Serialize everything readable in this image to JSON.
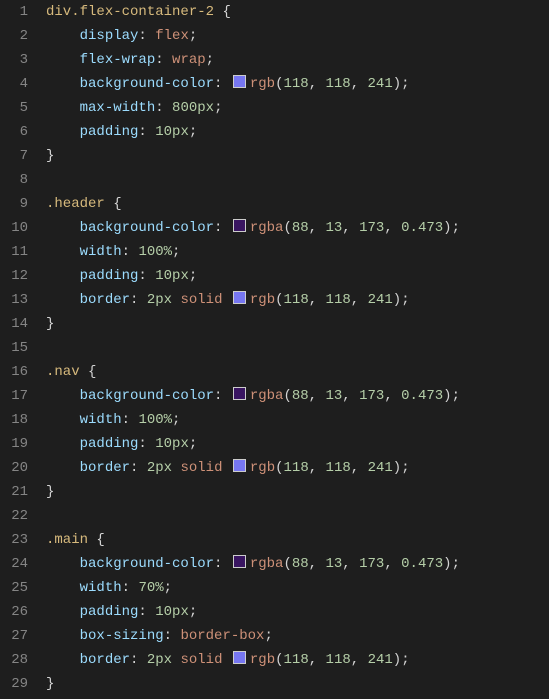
{
  "language": "css",
  "lines": [
    {
      "n": 1,
      "tokens": [
        {
          "t": "div",
          "c": "sel"
        },
        {
          "t": ".flex-container-2",
          "c": "sel"
        },
        {
          "t": " ",
          "c": "pn"
        },
        {
          "t": "{",
          "c": "br"
        }
      ]
    },
    {
      "n": 2,
      "tokens": [
        {
          "t": "    ",
          "c": "pn"
        },
        {
          "t": "display",
          "c": "prop"
        },
        {
          "t": ": ",
          "c": "pn"
        },
        {
          "t": "flex",
          "c": "val"
        },
        {
          "t": ";",
          "c": "pn"
        }
      ]
    },
    {
      "n": 3,
      "tokens": [
        {
          "t": "    ",
          "c": "pn"
        },
        {
          "t": "flex-wrap",
          "c": "prop"
        },
        {
          "t": ": ",
          "c": "pn"
        },
        {
          "t": "wrap",
          "c": "val"
        },
        {
          "t": ";",
          "c": "pn"
        }
      ]
    },
    {
      "n": 4,
      "tokens": [
        {
          "t": "    ",
          "c": "pn"
        },
        {
          "t": "background-color",
          "c": "prop"
        },
        {
          "t": ": ",
          "c": "pn"
        },
        {
          "swatch": "rgb(118,118,241)"
        },
        {
          "t": "rgb",
          "c": "func"
        },
        {
          "t": "(",
          "c": "pn"
        },
        {
          "t": "118",
          "c": "num"
        },
        {
          "t": ", ",
          "c": "pn"
        },
        {
          "t": "118",
          "c": "num"
        },
        {
          "t": ", ",
          "c": "pn"
        },
        {
          "t": "241",
          "c": "num"
        },
        {
          "t": ")",
          "c": "pn"
        },
        {
          "t": ";",
          "c": "pn"
        }
      ]
    },
    {
      "n": 5,
      "tokens": [
        {
          "t": "    ",
          "c": "pn"
        },
        {
          "t": "max-width",
          "c": "prop"
        },
        {
          "t": ": ",
          "c": "pn"
        },
        {
          "t": "800px",
          "c": "num"
        },
        {
          "t": ";",
          "c": "pn"
        }
      ]
    },
    {
      "n": 6,
      "tokens": [
        {
          "t": "    ",
          "c": "pn"
        },
        {
          "t": "padding",
          "c": "prop"
        },
        {
          "t": ": ",
          "c": "pn"
        },
        {
          "t": "10px",
          "c": "num"
        },
        {
          "t": ";",
          "c": "pn"
        }
      ]
    },
    {
      "n": 7,
      "tokens": [
        {
          "t": "}",
          "c": "br"
        }
      ]
    },
    {
      "n": 8,
      "tokens": []
    },
    {
      "n": 9,
      "tokens": [
        {
          "t": ".header",
          "c": "sel"
        },
        {
          "t": " ",
          "c": "pn"
        },
        {
          "t": "{",
          "c": "br"
        }
      ]
    },
    {
      "n": 10,
      "tokens": [
        {
          "t": "    ",
          "c": "pn"
        },
        {
          "t": "background-color",
          "c": "prop"
        },
        {
          "t": ": ",
          "c": "pn"
        },
        {
          "swatch": "rgba(88,13,173,0.473)"
        },
        {
          "t": "rgba",
          "c": "func"
        },
        {
          "t": "(",
          "c": "pn"
        },
        {
          "t": "88",
          "c": "num"
        },
        {
          "t": ", ",
          "c": "pn"
        },
        {
          "t": "13",
          "c": "num"
        },
        {
          "t": ", ",
          "c": "pn"
        },
        {
          "t": "173",
          "c": "num"
        },
        {
          "t": ", ",
          "c": "pn"
        },
        {
          "t": "0.473",
          "c": "num"
        },
        {
          "t": ")",
          "c": "pn"
        },
        {
          "t": ";",
          "c": "pn"
        }
      ]
    },
    {
      "n": 11,
      "tokens": [
        {
          "t": "    ",
          "c": "pn"
        },
        {
          "t": "width",
          "c": "prop"
        },
        {
          "t": ": ",
          "c": "pn"
        },
        {
          "t": "100%",
          "c": "num"
        },
        {
          "t": ";",
          "c": "pn"
        }
      ]
    },
    {
      "n": 12,
      "tokens": [
        {
          "t": "    ",
          "c": "pn"
        },
        {
          "t": "padding",
          "c": "prop"
        },
        {
          "t": ": ",
          "c": "pn"
        },
        {
          "t": "10px",
          "c": "num"
        },
        {
          "t": ";",
          "c": "pn"
        }
      ]
    },
    {
      "n": 13,
      "tokens": [
        {
          "t": "    ",
          "c": "pn"
        },
        {
          "t": "border",
          "c": "prop"
        },
        {
          "t": ": ",
          "c": "pn"
        },
        {
          "t": "2px",
          "c": "num"
        },
        {
          "t": " ",
          "c": "pn"
        },
        {
          "t": "solid",
          "c": "val"
        },
        {
          "t": " ",
          "c": "pn"
        },
        {
          "swatch": "rgb(118,118,241)"
        },
        {
          "t": "rgb",
          "c": "func"
        },
        {
          "t": "(",
          "c": "pn"
        },
        {
          "t": "118",
          "c": "num"
        },
        {
          "t": ", ",
          "c": "pn"
        },
        {
          "t": "118",
          "c": "num"
        },
        {
          "t": ", ",
          "c": "pn"
        },
        {
          "t": "241",
          "c": "num"
        },
        {
          "t": ")",
          "c": "pn"
        },
        {
          "t": ";",
          "c": "pn"
        }
      ]
    },
    {
      "n": 14,
      "tokens": [
        {
          "t": "}",
          "c": "br"
        }
      ]
    },
    {
      "n": 15,
      "tokens": []
    },
    {
      "n": 16,
      "tokens": [
        {
          "t": ".nav",
          "c": "sel"
        },
        {
          "t": " ",
          "c": "pn"
        },
        {
          "t": "{",
          "c": "br"
        }
      ]
    },
    {
      "n": 17,
      "tokens": [
        {
          "t": "    ",
          "c": "pn"
        },
        {
          "t": "background-color",
          "c": "prop"
        },
        {
          "t": ": ",
          "c": "pn"
        },
        {
          "swatch": "rgba(88,13,173,0.473)"
        },
        {
          "t": "rgba",
          "c": "func"
        },
        {
          "t": "(",
          "c": "pn"
        },
        {
          "t": "88",
          "c": "num"
        },
        {
          "t": ", ",
          "c": "pn"
        },
        {
          "t": "13",
          "c": "num"
        },
        {
          "t": ", ",
          "c": "pn"
        },
        {
          "t": "173",
          "c": "num"
        },
        {
          "t": ", ",
          "c": "pn"
        },
        {
          "t": "0.473",
          "c": "num"
        },
        {
          "t": ")",
          "c": "pn"
        },
        {
          "t": ";",
          "c": "pn"
        }
      ]
    },
    {
      "n": 18,
      "tokens": [
        {
          "t": "    ",
          "c": "pn"
        },
        {
          "t": "width",
          "c": "prop"
        },
        {
          "t": ": ",
          "c": "pn"
        },
        {
          "t": "100%",
          "c": "num"
        },
        {
          "t": ";",
          "c": "pn"
        }
      ]
    },
    {
      "n": 19,
      "tokens": [
        {
          "t": "    ",
          "c": "pn"
        },
        {
          "t": "padding",
          "c": "prop"
        },
        {
          "t": ": ",
          "c": "pn"
        },
        {
          "t": "10px",
          "c": "num"
        },
        {
          "t": ";",
          "c": "pn"
        }
      ]
    },
    {
      "n": 20,
      "tokens": [
        {
          "t": "    ",
          "c": "pn"
        },
        {
          "t": "border",
          "c": "prop"
        },
        {
          "t": ": ",
          "c": "pn"
        },
        {
          "t": "2px",
          "c": "num"
        },
        {
          "t": " ",
          "c": "pn"
        },
        {
          "t": "solid",
          "c": "val"
        },
        {
          "t": " ",
          "c": "pn"
        },
        {
          "swatch": "rgb(118,118,241)"
        },
        {
          "t": "rgb",
          "c": "func"
        },
        {
          "t": "(",
          "c": "pn"
        },
        {
          "t": "118",
          "c": "num"
        },
        {
          "t": ", ",
          "c": "pn"
        },
        {
          "t": "118",
          "c": "num"
        },
        {
          "t": ", ",
          "c": "pn"
        },
        {
          "t": "241",
          "c": "num"
        },
        {
          "t": ")",
          "c": "pn"
        },
        {
          "t": ";",
          "c": "pn"
        }
      ]
    },
    {
      "n": 21,
      "tokens": [
        {
          "t": "}",
          "c": "br"
        }
      ]
    },
    {
      "n": 22,
      "tokens": []
    },
    {
      "n": 23,
      "tokens": [
        {
          "t": ".main",
          "c": "sel"
        },
        {
          "t": " ",
          "c": "pn"
        },
        {
          "t": "{",
          "c": "br"
        }
      ]
    },
    {
      "n": 24,
      "tokens": [
        {
          "t": "    ",
          "c": "pn"
        },
        {
          "t": "background-color",
          "c": "prop"
        },
        {
          "t": ": ",
          "c": "pn"
        },
        {
          "swatch": "rgba(88,13,173,0.473)"
        },
        {
          "t": "rgba",
          "c": "func"
        },
        {
          "t": "(",
          "c": "pn"
        },
        {
          "t": "88",
          "c": "num"
        },
        {
          "t": ", ",
          "c": "pn"
        },
        {
          "t": "13",
          "c": "num"
        },
        {
          "t": ", ",
          "c": "pn"
        },
        {
          "t": "173",
          "c": "num"
        },
        {
          "t": ", ",
          "c": "pn"
        },
        {
          "t": "0.473",
          "c": "num"
        },
        {
          "t": ")",
          "c": "pn"
        },
        {
          "t": ";",
          "c": "pn"
        }
      ]
    },
    {
      "n": 25,
      "tokens": [
        {
          "t": "    ",
          "c": "pn"
        },
        {
          "t": "width",
          "c": "prop"
        },
        {
          "t": ": ",
          "c": "pn"
        },
        {
          "t": "70%",
          "c": "num"
        },
        {
          "t": ";",
          "c": "pn"
        }
      ]
    },
    {
      "n": 26,
      "tokens": [
        {
          "t": "    ",
          "c": "pn"
        },
        {
          "t": "padding",
          "c": "prop"
        },
        {
          "t": ": ",
          "c": "pn"
        },
        {
          "t": "10px",
          "c": "num"
        },
        {
          "t": ";",
          "c": "pn"
        }
      ]
    },
    {
      "n": 27,
      "tokens": [
        {
          "t": "    ",
          "c": "pn"
        },
        {
          "t": "box-sizing",
          "c": "prop"
        },
        {
          "t": ": ",
          "c": "pn"
        },
        {
          "t": "border-box",
          "c": "val"
        },
        {
          "t": ";",
          "c": "pn"
        }
      ]
    },
    {
      "n": 28,
      "tokens": [
        {
          "t": "    ",
          "c": "pn"
        },
        {
          "t": "border",
          "c": "prop"
        },
        {
          "t": ": ",
          "c": "pn"
        },
        {
          "t": "2px",
          "c": "num"
        },
        {
          "t": " ",
          "c": "pn"
        },
        {
          "t": "solid",
          "c": "val"
        },
        {
          "t": " ",
          "c": "pn"
        },
        {
          "swatch": "rgb(118,118,241)"
        },
        {
          "t": "rgb",
          "c": "func"
        },
        {
          "t": "(",
          "c": "pn"
        },
        {
          "t": "118",
          "c": "num"
        },
        {
          "t": ", ",
          "c": "pn"
        },
        {
          "t": "118",
          "c": "num"
        },
        {
          "t": ", ",
          "c": "pn"
        },
        {
          "t": "241",
          "c": "num"
        },
        {
          "t": ")",
          "c": "pn"
        },
        {
          "t": ";",
          "c": "pn"
        }
      ]
    },
    {
      "n": 29,
      "tokens": [
        {
          "t": "}",
          "c": "br"
        }
      ]
    }
  ]
}
